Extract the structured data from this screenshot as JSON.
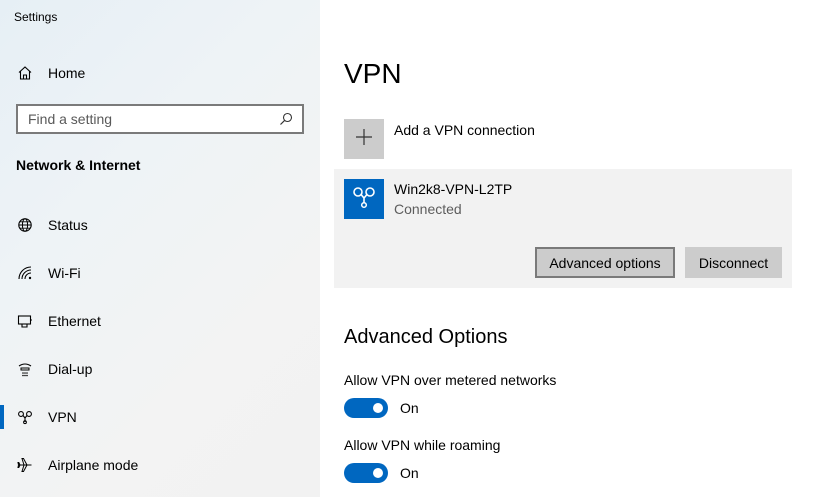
{
  "app": {
    "title": "Settings"
  },
  "sidebar": {
    "home_label": "Home",
    "search_placeholder": "Find a setting",
    "section_title": "Network & Internet",
    "items": [
      {
        "label": "Status",
        "icon": "globe-icon",
        "active": false
      },
      {
        "label": "Wi-Fi",
        "icon": "wifi-icon",
        "active": false
      },
      {
        "label": "Ethernet",
        "icon": "ethernet-icon",
        "active": false
      },
      {
        "label": "Dial-up",
        "icon": "dialup-icon",
        "active": false
      },
      {
        "label": "VPN",
        "icon": "vpn-icon",
        "active": true
      },
      {
        "label": "Airplane mode",
        "icon": "airplane-icon",
        "active": false
      }
    ]
  },
  "main": {
    "title": "VPN",
    "add_label": "Add a VPN connection",
    "connection": {
      "name": "Win2k8-VPN-L2TP",
      "status": "Connected",
      "advanced_button": "Advanced options",
      "disconnect_button": "Disconnect"
    },
    "advanced": {
      "title": "Advanced Options",
      "settings": [
        {
          "label": "Allow VPN over metered networks",
          "state": "On"
        },
        {
          "label": "Allow VPN while roaming",
          "state": "On"
        }
      ]
    }
  },
  "colors": {
    "accent": "#0067c0",
    "button": "#cccccc",
    "card": "#f2f2f2"
  }
}
